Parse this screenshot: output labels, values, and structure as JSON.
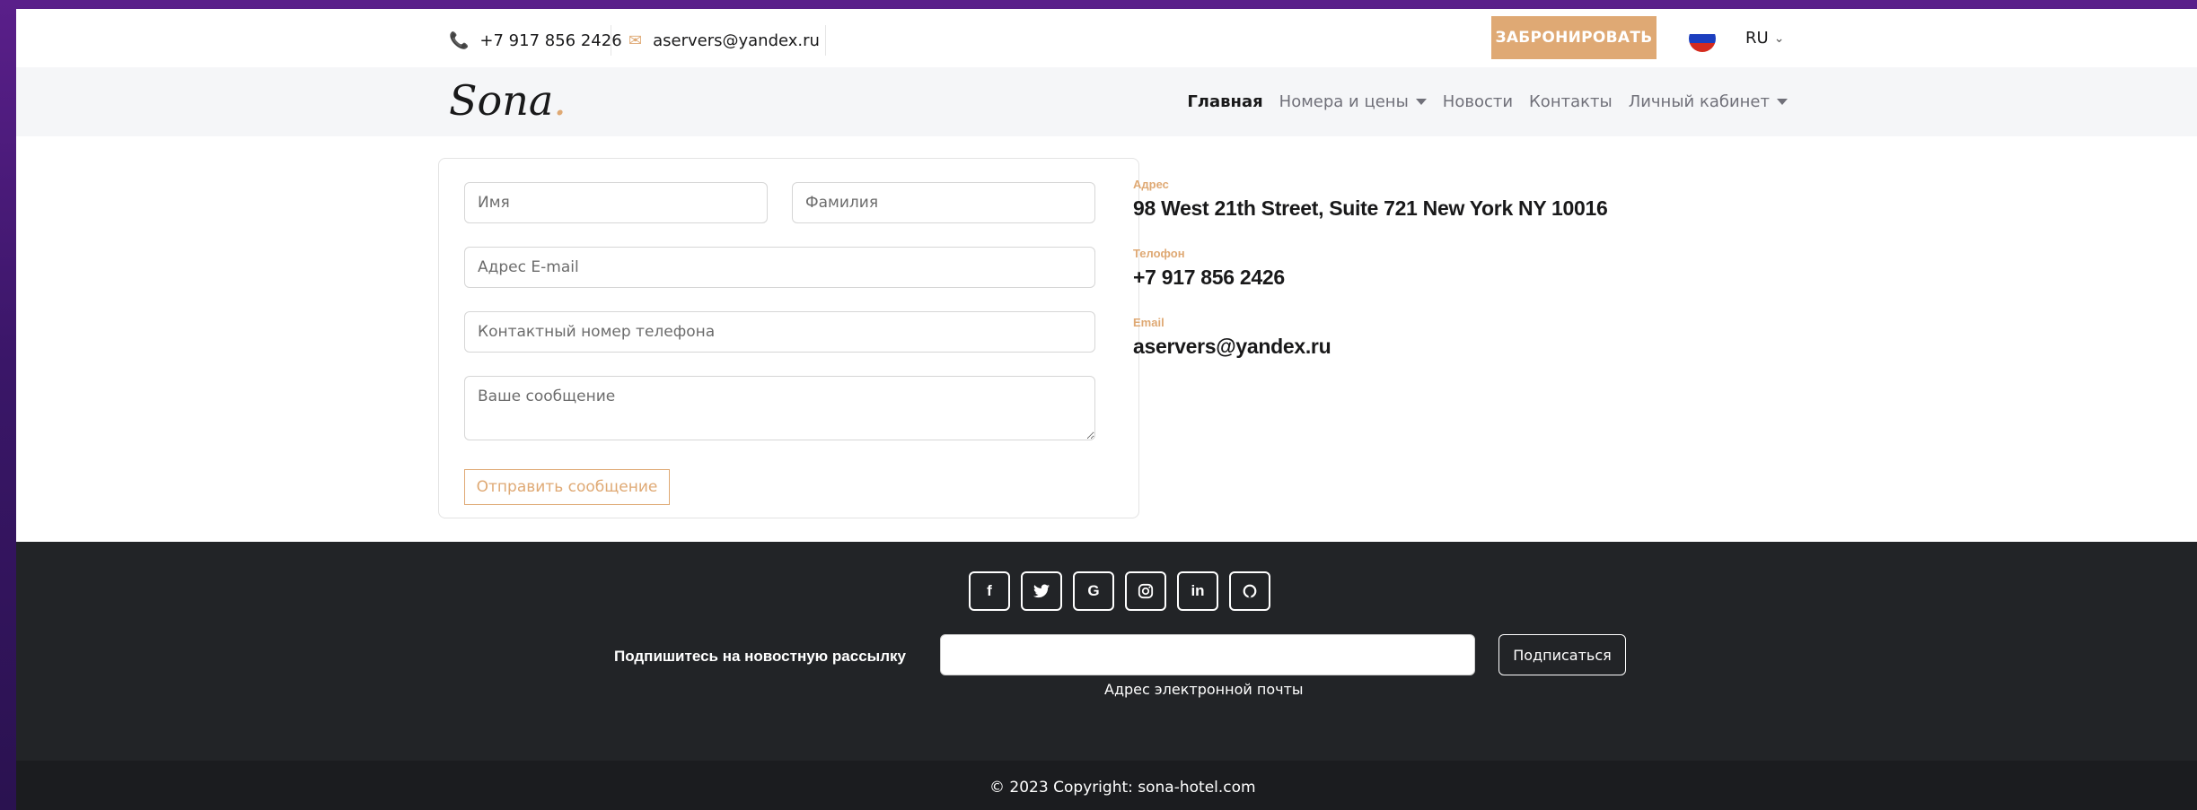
{
  "topbar": {
    "phone": "+7 917 856 2426",
    "email": "aservers@yandex.ru",
    "book_label": "ЗАБРОНИРОВАТЬ",
    "lang": "RU",
    "phone_icon": "phone-icon",
    "email_icon": "envelope-icon"
  },
  "brand": {
    "logo": "Sona",
    "logo_dot": "."
  },
  "nav": {
    "items": [
      {
        "label": "Главная",
        "active": true
      },
      {
        "label": "Номера и цены",
        "dropdown": true
      },
      {
        "label": "Новости"
      },
      {
        "label": "Контакты"
      },
      {
        "label": "Личный кабинет",
        "dropdown": true
      }
    ]
  },
  "form": {
    "first_name_placeholder": "Имя",
    "last_name_placeholder": "Фамилия",
    "email_placeholder": "Адрес E-mail",
    "phone_placeholder": "Контактный номер телефона",
    "message_placeholder": "Ваше сообщение",
    "submit_label": "Отправить сообщение"
  },
  "contact_info": {
    "address_label": "Адрес",
    "address_value": "98 West 21th Street, Suite 721 New York NY 10016",
    "phone_label": "Телофон",
    "phone_value": "+7 917 856 2426",
    "email_label": "Email",
    "email_value": "aservers@yandex.ru"
  },
  "footer": {
    "socials": [
      {
        "icon": "facebook-icon",
        "glyph": "f"
      },
      {
        "icon": "twitter-icon",
        "glyph": "🐦"
      },
      {
        "icon": "google-icon",
        "glyph": "G"
      },
      {
        "icon": "instagram-icon",
        "glyph": "◎"
      },
      {
        "icon": "linkedin-icon",
        "glyph": "in"
      },
      {
        "icon": "github-icon",
        "glyph": "◐"
      }
    ],
    "subscribe_label": "Подпишитесь на новостную рассылку",
    "subscribe_hint": "Адрес электронной почты",
    "subscribe_button": "Подписаться",
    "copyright": "© 2023 Copyright: sona-hotel.com"
  },
  "colors": {
    "accent": "#dfa974",
    "footer_bg": "#222427",
    "copyright_bg": "#1b1c1f"
  }
}
